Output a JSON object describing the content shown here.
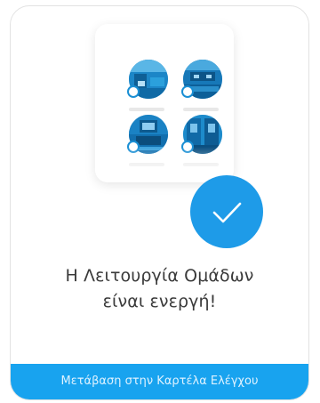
{
  "message": {
    "line1": "Η Λειτουργία Ομάδων",
    "line2": "είναι ενεργή!"
  },
  "cta": {
    "label": "Μετάβαση στην Καρτέλα Ελέγχου"
  },
  "colors": {
    "accent": "#1e9be8",
    "cta_background": "#18a3ef"
  },
  "illustration": {
    "camera_count": 4,
    "badge_icon": "checkmark-icon"
  }
}
